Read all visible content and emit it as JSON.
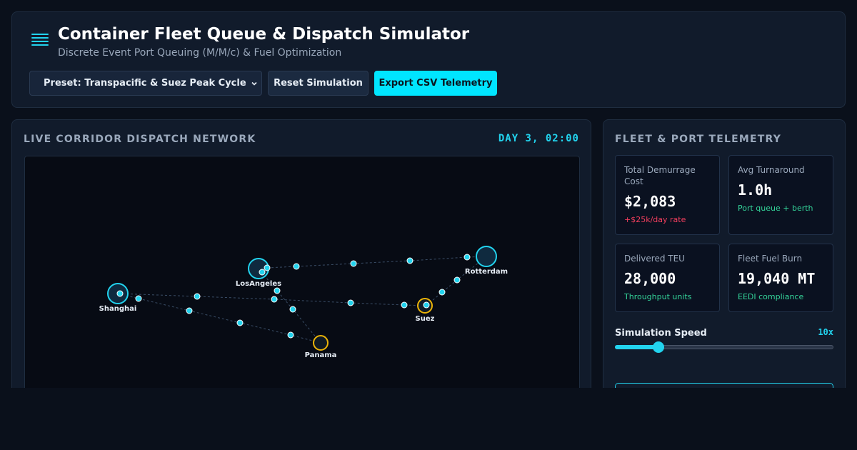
{
  "header": {
    "title": "Container Fleet Queue & Dispatch Simulator",
    "subtitle": "Discrete Event Port Queuing (M/M/c) & Fuel Optimization",
    "menu_icon": "menu-lines-icon",
    "preset_label": "Preset: Transpacific & Suez Peak Cycle",
    "reset_label": "Reset Simulation",
    "export_label": "Export CSV Telemetry"
  },
  "map_panel": {
    "title": "LIVE CORRIDOR DISPATCH NETWORK",
    "clock": "DAY 3, 02:00",
    "ports": {
      "shanghai": "Shanghai",
      "los_angeles": "LosAngeles",
      "rotterdam": "Rotterdam",
      "suez": "Suez",
      "panama": "Panama"
    }
  },
  "telemetry": {
    "title": "FLEET & PORT TELEMETRY",
    "cards": [
      {
        "label": "Total Demurrage Cost",
        "value": "$2,083",
        "note": "+$25k/day rate"
      },
      {
        "label": "Avg Turnaround",
        "value": "1.0h",
        "note": "Port queue + berth"
      },
      {
        "label": "Delivered TEU",
        "value": "28,000",
        "note": "Throughput units"
      },
      {
        "label": "Fleet Fuel Burn",
        "value": "19,040 MT",
        "note": "EEDI compliance"
      }
    ],
    "speed_label": "Simulation Speed",
    "speed_value": "10x",
    "speed_fraction": 0.2
  },
  "colors": {
    "accent": "#22d3ee",
    "congested_port": "#eab308",
    "alert": "#f43f5e",
    "positive": "#34d399"
  }
}
